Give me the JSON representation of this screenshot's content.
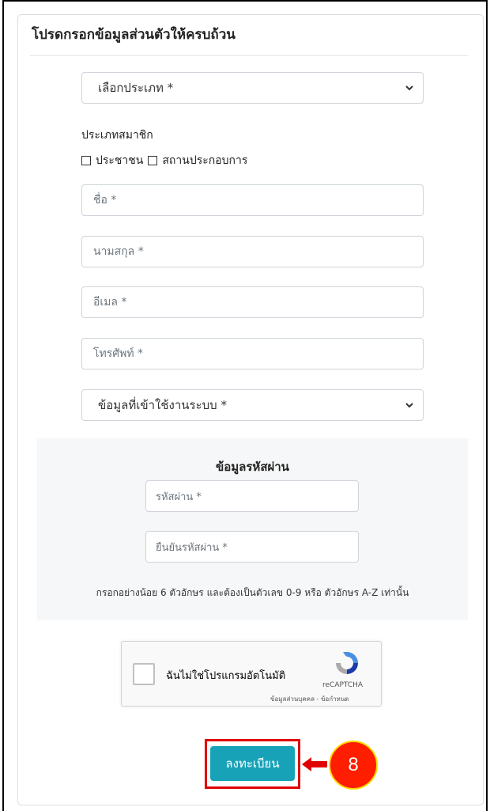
{
  "form": {
    "title": "โปรดกรอกข้อมูลส่วนตัวให้ครบถ้วน",
    "type_select": "เลือกประเภท *",
    "member_type_label": "ประเภทสมาชิก",
    "checkbox_citizen": "ประชาชน",
    "checkbox_business": "สถานประกอบการ",
    "first_name_placeholder": "ชื่อ *",
    "last_name_placeholder": "นามสกุล *",
    "email_placeholder": "อีเมล *",
    "phone_placeholder": "โทรศัพท์ *",
    "usage_select": "ข้อมูลที่เข้าใช้งานระบบ *"
  },
  "password": {
    "title": "ข้อมูลรหัสผ่าน",
    "password_placeholder": "รหัสผ่าน *",
    "confirm_placeholder": "ยืนยันรหัสผ่าน *",
    "hint": "กรอกอย่างน้อย 6 ตัวอักษร และต้องเป็นตัวเลข 0-9 หรือ ตัวอักษร A-Z เท่านั้น"
  },
  "captcha": {
    "label": "ฉันไม่ใช่โปรแกรมอัตโนมัติ",
    "brand": "reCAPTCHA",
    "links": "ข้อมูลส่วนบุคคล - ข้อกำหนด"
  },
  "submit_label": "ลงทะเบียน",
  "step_marker": "8",
  "colors": {
    "button": "#17a2b8",
    "highlight": "#e00000",
    "marker": "#ff1e00"
  }
}
